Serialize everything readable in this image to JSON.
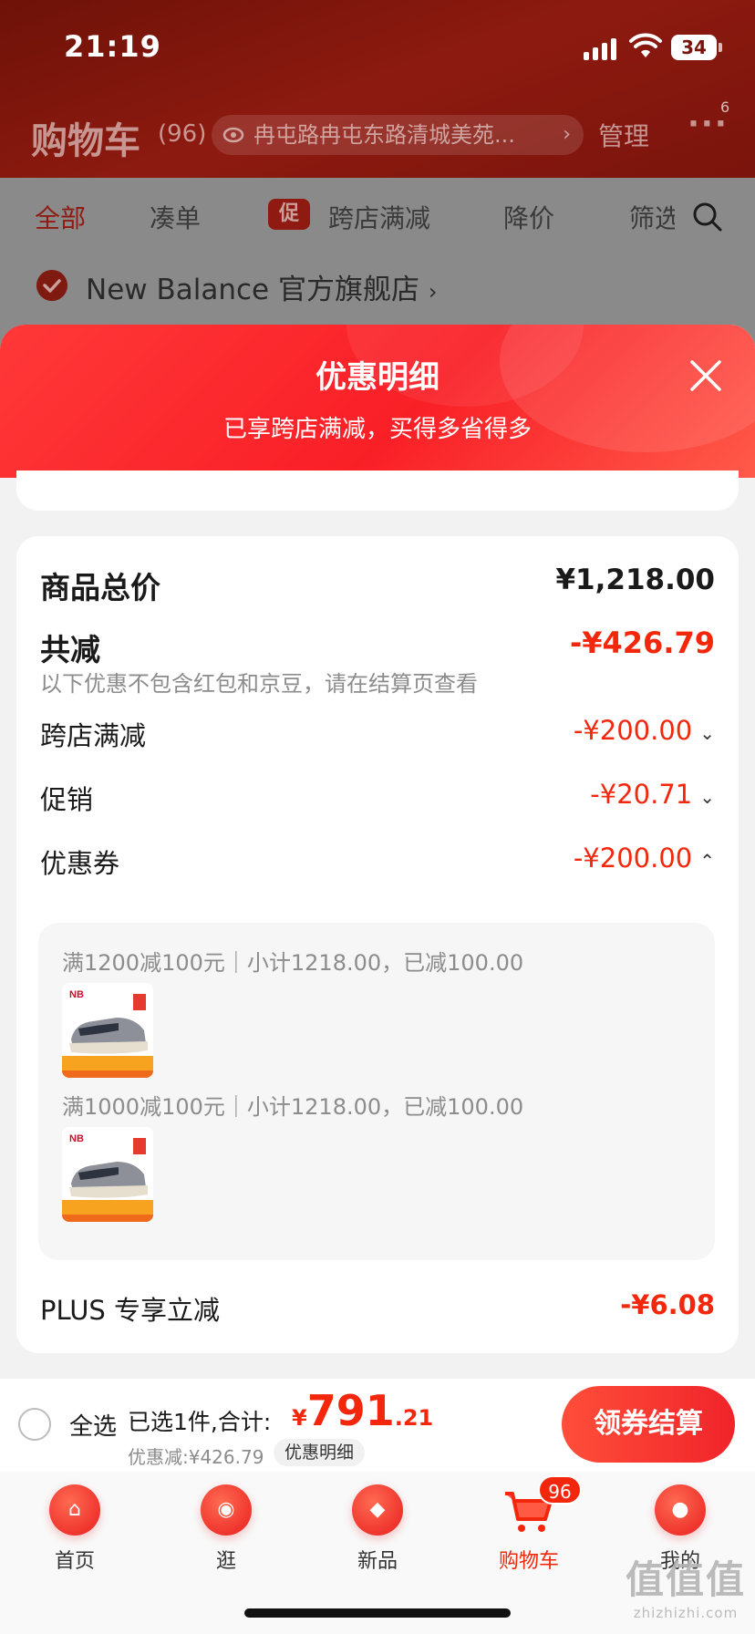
{
  "status_bar": {
    "time": "21:19",
    "battery": "34"
  },
  "header": {
    "title": "购物车",
    "count": "(96)",
    "address": "冉屯路冉屯东路清城美苑...",
    "manage": "管理",
    "more_badge": "6"
  },
  "filter_tabs": [
    "全部",
    "凑单",
    "跨店满减",
    "降价",
    "筛选"
  ],
  "promo_tag": "促",
  "store": {
    "name": "New Balance 官方旗舰店",
    "chevron": "›"
  },
  "sheet": {
    "title": "优惠明细",
    "subtitle": "已享跨店满减，买得多省得多",
    "rows": {
      "total_label": "商品总价",
      "total_value": "¥1,218.00",
      "reduce_label": "共减",
      "reduce_value": "-¥426.79",
      "note": "以下优惠不包含红包和京豆，请在结算页查看",
      "cross_store_label": "跨店满减",
      "cross_store_value": "-¥200.00",
      "promo_label": "促销",
      "promo_value": "-¥20.71",
      "coupon_label": "优惠券",
      "coupon_value": "-¥200.00",
      "plus_label": "PLUS 专享立减",
      "plus_value": "-¥6.08"
    },
    "coupons": [
      {
        "text": "满1200减100元｜小计1218.00，已减100.00"
      },
      {
        "text": "满1000减100元｜小计1218.00，已减100.00"
      }
    ]
  },
  "checkout": {
    "select_all": "全选",
    "selected": "已选1件,合计:",
    "currency": "¥",
    "total_main": "791",
    "total_cents": ".21",
    "discount": "优惠减:¥426.79",
    "detail_link": "优惠明细",
    "button": "领券结算"
  },
  "tab_bar": [
    {
      "label": "首页",
      "icon": "home-icon"
    },
    {
      "label": "逛",
      "icon": "explore-icon"
    },
    {
      "label": "新品",
      "icon": "new-products-icon"
    },
    {
      "label": "购物车",
      "icon": "cart-icon",
      "badge": "96"
    },
    {
      "label": "我的",
      "icon": "profile-icon"
    }
  ],
  "watermark": {
    "logo": "值值值",
    "url": "zhizhizhi.com"
  },
  "colors": {
    "accent": "#f2270c",
    "header_red": "#ff3838"
  }
}
